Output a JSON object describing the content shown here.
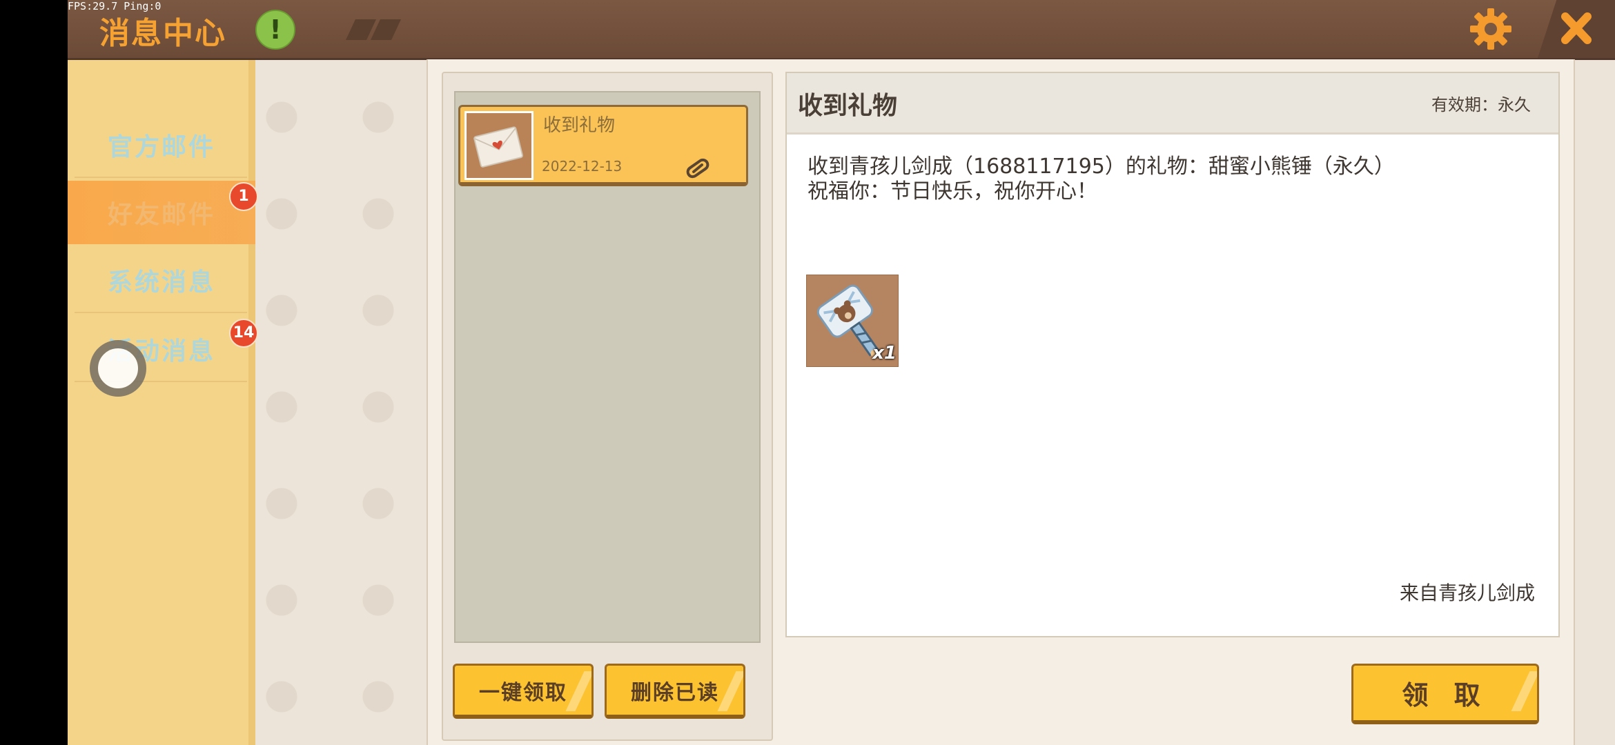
{
  "debug": {
    "fps_text": "FPS:29.7  Ping:0"
  },
  "header": {
    "title": "消息中心",
    "alert_symbol": "!"
  },
  "sidebar": {
    "items": [
      {
        "label": "官方邮件",
        "active": false,
        "badge": null
      },
      {
        "label": "好友邮件",
        "active": true,
        "badge": "1"
      },
      {
        "label": "系统消息",
        "active": false,
        "badge": null
      },
      {
        "label": "活动消息",
        "active": false,
        "badge": "14"
      }
    ]
  },
  "mail_list": {
    "items": [
      {
        "title": "收到礼物",
        "date": "2022-12-13",
        "has_attachment": true
      }
    ],
    "buttons": {
      "claim_all": "一键领取",
      "delete_read": "删除已读"
    }
  },
  "detail": {
    "title": "收到礼物",
    "validity": "有效期：永久",
    "lines": [
      "收到青孩儿剑成（1688117195）的礼物：甜蜜小熊锤（永久）",
      "祝福你：节日快乐，祝你开心！"
    ],
    "gift": {
      "icon": "hammer-icon",
      "count": "x1"
    },
    "sender": "来自青孩儿剑成",
    "claim_button": "领 取"
  },
  "colors": {
    "topbar": "#7b5842",
    "title": "#f5a233",
    "sidebar": "#f4d489",
    "button": "#fcc230",
    "badge": "#e8492c",
    "alert": "#8bc34a"
  }
}
